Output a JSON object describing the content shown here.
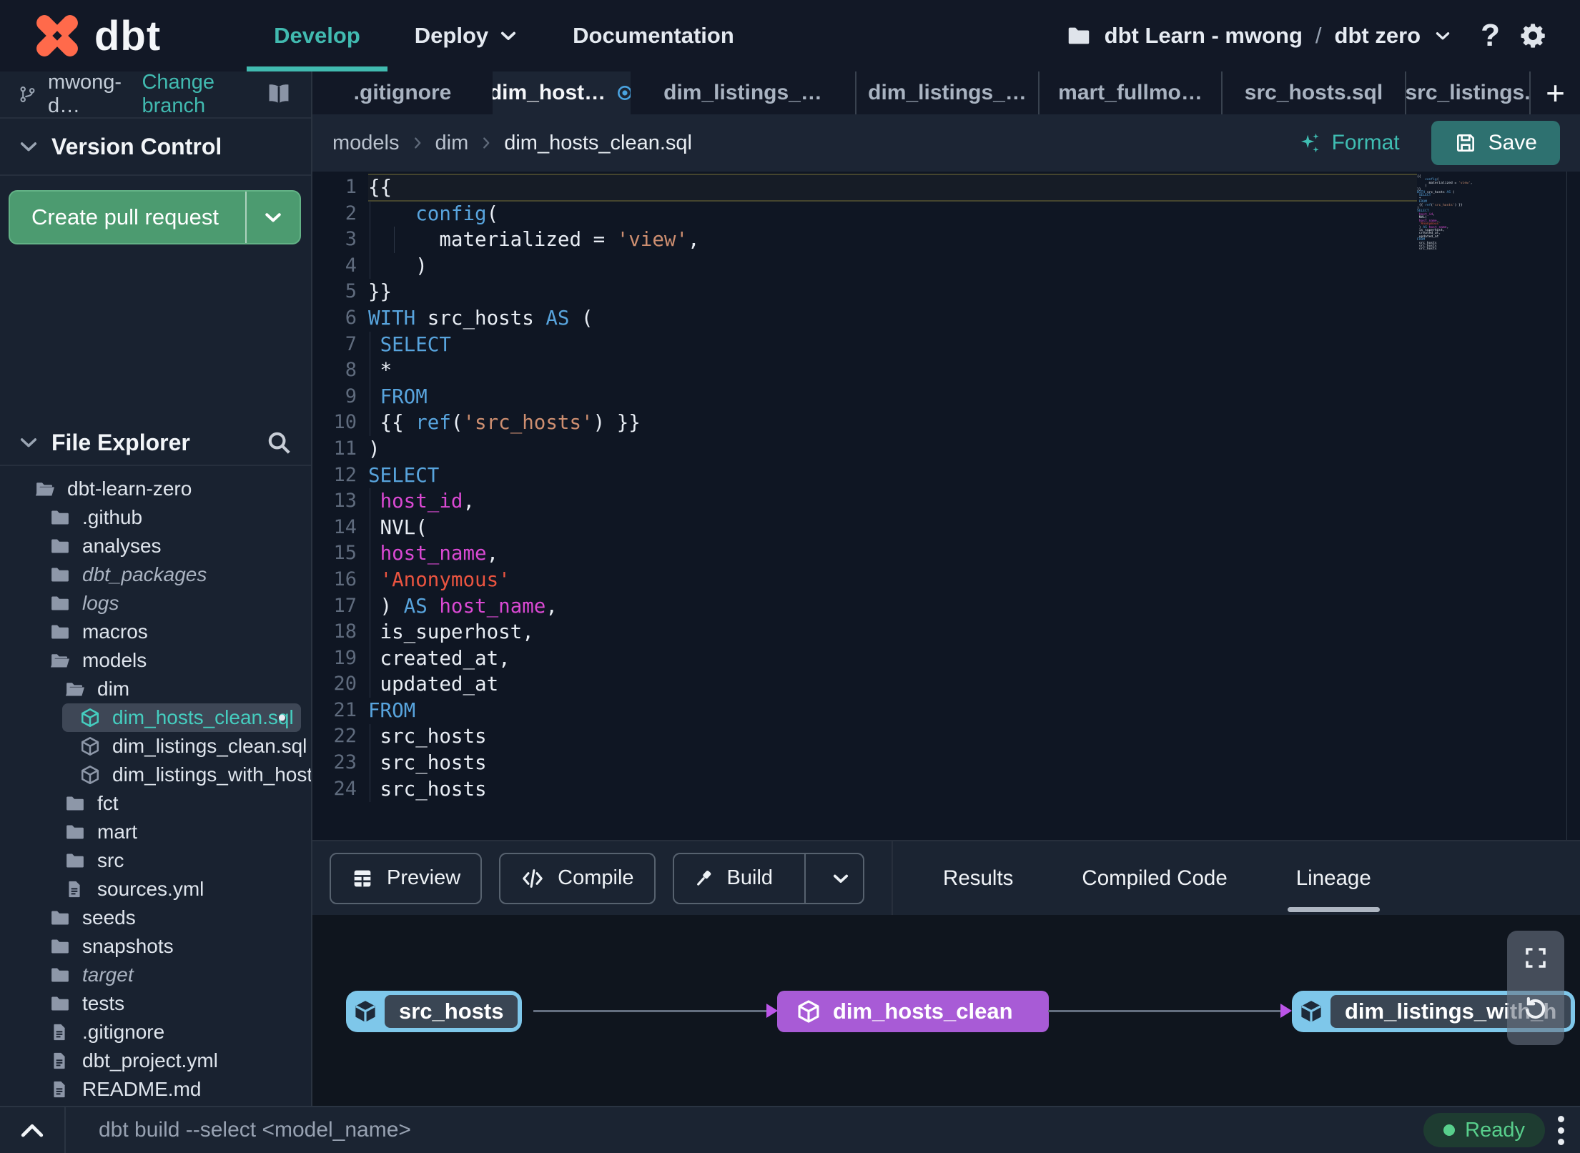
{
  "topbar": {
    "brand": "dbt",
    "nav": [
      {
        "label": "Develop",
        "active": true,
        "caret": false
      },
      {
        "label": "Deploy",
        "active": false,
        "caret": true
      },
      {
        "label": "Documentation",
        "active": false,
        "caret": false
      }
    ],
    "project": {
      "account": "dbt Learn - mwong",
      "separator": "/",
      "name": "dbt zero"
    },
    "help_glyph": "?"
  },
  "sidebar": {
    "branch": {
      "name": "mwong-d…",
      "action": "Change branch"
    },
    "version_control": {
      "title": "Version Control",
      "button_label": "Create pull request"
    },
    "file_explorer": {
      "title": "File Explorer",
      "tree": [
        {
          "label": "dbt-learn-zero",
          "depth": 0,
          "icon": "folder-open-icon"
        },
        {
          "label": ".github",
          "depth": 1,
          "icon": "folder-icon"
        },
        {
          "label": "analyses",
          "depth": 1,
          "icon": "folder-icon"
        },
        {
          "label": "dbt_packages",
          "depth": 1,
          "icon": "folder-icon",
          "italic": true
        },
        {
          "label": "logs",
          "depth": 1,
          "icon": "folder-icon",
          "italic": true
        },
        {
          "label": "macros",
          "depth": 1,
          "icon": "folder-icon"
        },
        {
          "label": "models",
          "depth": 1,
          "icon": "folder-open-icon"
        },
        {
          "label": "dim",
          "depth": 2,
          "icon": "folder-open-icon"
        },
        {
          "label": "dim_hosts_clean.sql",
          "depth": 3,
          "icon": "model-cube-icon",
          "selected": true,
          "modified": true
        },
        {
          "label": "dim_listings_clean.sql",
          "depth": 3,
          "icon": "model-cube-icon"
        },
        {
          "label": "dim_listings_with_hosts…",
          "depth": 3,
          "icon": "model-cube-icon"
        },
        {
          "label": "fct",
          "depth": 2,
          "icon": "folder-icon"
        },
        {
          "label": "mart",
          "depth": 2,
          "icon": "folder-icon"
        },
        {
          "label": "src",
          "depth": 2,
          "icon": "folder-icon"
        },
        {
          "label": "sources.yml",
          "depth": 2,
          "icon": "file-icon"
        },
        {
          "label": "seeds",
          "depth": 1,
          "icon": "folder-icon"
        },
        {
          "label": "snapshots",
          "depth": 1,
          "icon": "folder-icon"
        },
        {
          "label": "target",
          "depth": 1,
          "icon": "folder-icon",
          "italic": true
        },
        {
          "label": "tests",
          "depth": 1,
          "icon": "folder-icon"
        },
        {
          "label": ".gitignore",
          "depth": 1,
          "icon": "file-icon"
        },
        {
          "label": "dbt_project.yml",
          "depth": 1,
          "icon": "file-icon"
        },
        {
          "label": "README.md",
          "depth": 1,
          "icon": "file-icon"
        }
      ]
    }
  },
  "tabs": [
    {
      "label": ".gitignore"
    },
    {
      "label": "dim_host…",
      "active": true,
      "modified": true
    },
    {
      "label": "dim_listings_…"
    },
    {
      "label": "dim_listings_…"
    },
    {
      "label": "mart_fullmo…"
    },
    {
      "label": "src_hosts.sql"
    },
    {
      "label": "src_listings."
    }
  ],
  "tab_plus": "+",
  "breadcrumb": [
    "models",
    "dim",
    "dim_hosts_clean.sql"
  ],
  "editor_header": {
    "format_label": "Format",
    "save_label": "Save"
  },
  "code": {
    "lines": [
      [
        [
          "{{",
          "w"
        ]
      ],
      [
        [
          "    ",
          "w"
        ],
        [
          "config",
          "k"
        ],
        [
          "(",
          "w"
        ]
      ],
      [
        [
          "      materialized = ",
          "w"
        ],
        [
          "'view'",
          "s"
        ],
        [
          ",",
          "w"
        ]
      ],
      [
        [
          "    )",
          "w"
        ]
      ],
      [
        [
          "}}",
          "w"
        ]
      ],
      [
        [
          "WITH",
          "k"
        ],
        [
          " src_hosts ",
          "w"
        ],
        [
          "AS",
          "k"
        ],
        [
          " (",
          "w"
        ]
      ],
      [
        [
          " ",
          "w"
        ],
        [
          "SELECT",
          "k"
        ]
      ],
      [
        [
          " *",
          "w"
        ]
      ],
      [
        [
          " ",
          "w"
        ],
        [
          "FROM",
          "k"
        ]
      ],
      [
        [
          " {{ ",
          "w"
        ],
        [
          "ref",
          "k"
        ],
        [
          "(",
          "w"
        ],
        [
          "'src_hosts'",
          "s"
        ],
        [
          ") }}",
          "w"
        ]
      ],
      [
        [
          ")",
          "w"
        ]
      ],
      [
        [
          "SELECT",
          "k"
        ]
      ],
      [
        [
          " ",
          "w"
        ],
        [
          "host_id",
          "m"
        ],
        [
          ",",
          "w"
        ]
      ],
      [
        [
          " NVL(",
          "w"
        ]
      ],
      [
        [
          " ",
          "w"
        ],
        [
          "host_name",
          "m"
        ],
        [
          ",",
          "w"
        ]
      ],
      [
        [
          " ",
          "w"
        ],
        [
          "'Anonymous'",
          "r"
        ]
      ],
      [
        [
          " ) ",
          "w"
        ],
        [
          "AS",
          "k"
        ],
        [
          " ",
          "w"
        ],
        [
          "host_name",
          "m"
        ],
        [
          ",",
          "w"
        ]
      ],
      [
        [
          " is_superhost,",
          "w"
        ]
      ],
      [
        [
          " created_at,",
          "w"
        ]
      ],
      [
        [
          " updated_at",
          "w"
        ]
      ],
      [
        [
          "FROM",
          "k"
        ]
      ],
      [
        [
          " src_hosts",
          "w"
        ]
      ],
      [
        [
          " src_hosts",
          "w"
        ]
      ],
      [
        [
          " src_hosts",
          "w"
        ]
      ]
    ]
  },
  "bottom_toolbar": {
    "buttons": [
      {
        "label": "Preview",
        "icon": "preview-table-icon"
      },
      {
        "label": "Compile",
        "icon": "compile-code-icon"
      },
      {
        "label": "Build",
        "icon": "build-hammer-icon",
        "split": true
      }
    ],
    "tabs": [
      {
        "label": "Results"
      },
      {
        "label": "Compiled Code"
      },
      {
        "label": "Lineage",
        "active": true
      }
    ]
  },
  "lineage": {
    "nodes": [
      {
        "label": "src_hosts",
        "style": "source"
      },
      {
        "label": "dim_hosts_clean",
        "style": "model"
      },
      {
        "label": "dim_listings_with_h",
        "style": "source"
      }
    ]
  },
  "statusbar": {
    "command": "dbt build --select <model_name>",
    "status_label": "Ready"
  },
  "colors": {
    "accent_teal": "#41bab0",
    "pr_button_green": "#4c9b70",
    "save_button_teal": "#2e7170",
    "tab_modified_blue": "#4aa3e0",
    "lineage_node_blue": "#7ec7ea",
    "lineage_node_purple": "#a85bd6",
    "lineage_arrow_purple": "#bb55e8",
    "status_ready_green": "#58cf8c",
    "code_keyword": "#58a4dd",
    "code_string": "#cd8e70",
    "code_string_red": "#ea5440",
    "code_identifier_magenta": "#da49d3"
  }
}
